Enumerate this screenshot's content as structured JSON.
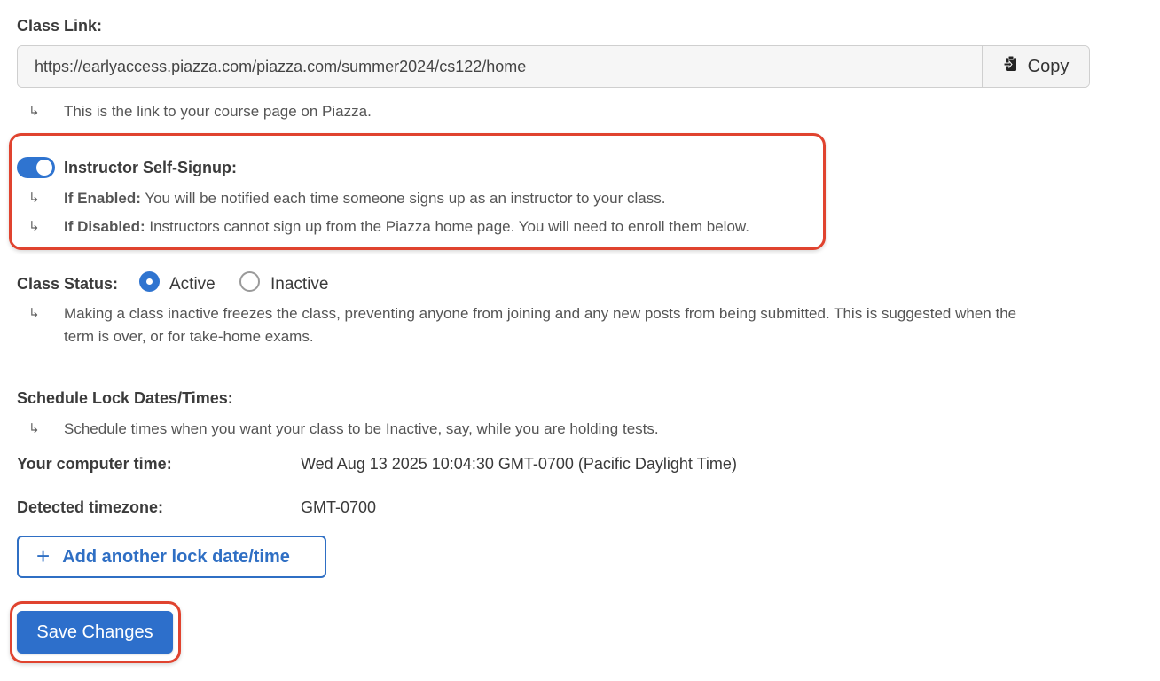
{
  "class_link": {
    "label": "Class Link:",
    "value": "https://earlyaccess.piazza.com/piazza.com/summer2024/cs122/home",
    "copy_label": "Copy",
    "copy_icon": "clipboard-icon",
    "hint": "This is the link to your course page on Piazza."
  },
  "self_signup": {
    "label": "Instructor Self-Signup:",
    "enabled": true,
    "enabled_prefix": "If Enabled:",
    "enabled_text": " You will be notified each time someone signs up as an instructor to your class.",
    "disabled_prefix": "If Disabled:",
    "disabled_text": " Instructors cannot sign up from the Piazza home page. You will need to enroll them below."
  },
  "class_status": {
    "label": "Class Status:",
    "options": [
      "Active",
      "Inactive"
    ],
    "selected": "Active",
    "hint_line1": "Making a class inactive freezes the class, preventing anyone from joining and any new posts from being submitted. This is suggested when the",
    "hint_line2": "term is over, or for take-home exams."
  },
  "lock_dates": {
    "label": "Schedule Lock Dates/Times:",
    "hint": "Schedule times when you want your class to be Inactive, say, while you are holding tests.",
    "computer_time_label": "Your computer time:",
    "computer_time_value": "Wed Aug 13 2025 10:04:30 GMT-0700 (Pacific Daylight Time)",
    "timezone_label": "Detected timezone:",
    "timezone_value": "GMT-0700",
    "add_button_label": "Add another lock date/time"
  },
  "save_button_label": "Save Changes",
  "arrow_glyph": "↳",
  "colors": {
    "accent": "#2f74d0",
    "highlight": "#e0432f"
  }
}
